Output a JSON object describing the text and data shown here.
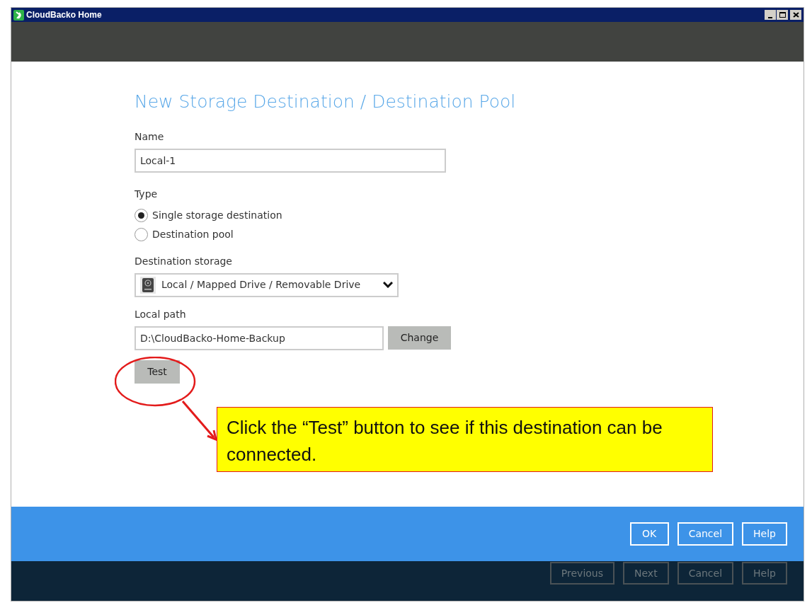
{
  "window": {
    "title": "CloudBacko Home"
  },
  "form": {
    "title": "New Storage Destination / Destination Pool",
    "name": {
      "label": "Name",
      "value": "Local-1"
    },
    "type": {
      "label": "Type",
      "options": [
        {
          "label": "Single storage destination",
          "selected": true
        },
        {
          "label": "Destination pool",
          "selected": false
        }
      ]
    },
    "destination_storage": {
      "label": "Destination storage",
      "value": "Local / Mapped Drive / Removable Drive"
    },
    "local_path": {
      "label": "Local path",
      "value": "D:\\CloudBacko-Home-Backup",
      "button": "Change"
    },
    "test_button": "Test"
  },
  "callout": {
    "text": "Click the “Test” button to see if this destination can be connected."
  },
  "dialog_buttons": [
    "OK",
    "Cancel",
    "Help"
  ],
  "wizard_buttons": [
    {
      "label": "Previous",
      "disabled": true
    },
    {
      "label": "Next",
      "disabled": true
    },
    {
      "label": "Cancel",
      "disabled": true
    },
    {
      "label": "Help",
      "disabled": true
    }
  ]
}
